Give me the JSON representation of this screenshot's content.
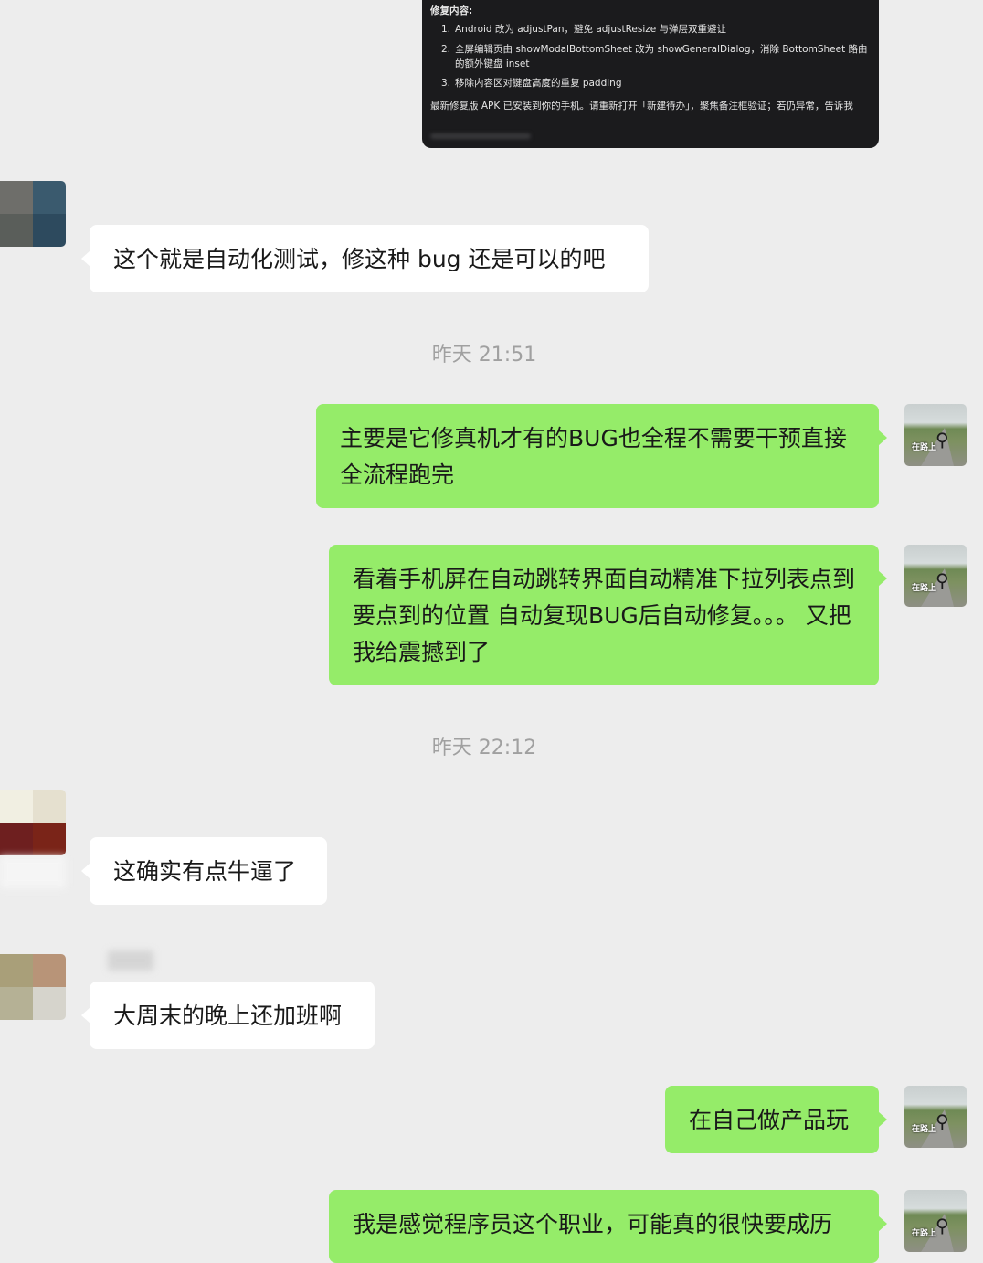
{
  "screenshot_message": {
    "heading": "修复内容:",
    "items": [
      {
        "num": "1.",
        "text": "Android 改为 adjustPan，避免 adjustResize 与弹层双重避让"
      },
      {
        "num": "2.",
        "text": "全屏编辑页由 showModalBottomSheet 改为 showGeneralDialog，消除 BottomSheet 路由的额外键盘 inset"
      },
      {
        "num": "3.",
        "text": "移除内容区对键盘高度的重复 padding"
      }
    ],
    "footer": "最新修复版 APK 已安装到你的手机。请重新打开「新建待办」，聚焦备注框验证；若仍异常，告诉我"
  },
  "messages": {
    "m1": "这个就是自动化测试，修这种 bug 还是可以的吧",
    "t1": "昨天 21:51",
    "m2": "主要是它修真机才有的BUG也全程不需要干预直接全流程跑完",
    "m3": "看着手机屏在自动跳转界面自动精准下拉列表点到要点到的位置 自动复现BUG后自动修复。。。 又把我给震撼到了",
    "t2": "昨天 22:12",
    "m4": "这确实有点牛逼了",
    "m5": "大周末的晚上还加班啊",
    "m6": "在自己做产品玩",
    "m7": "我是感觉程序员这个职业，可能真的很快要成历"
  },
  "avatar_caption": "在路上",
  "colors": {
    "background": "#ededed",
    "bubble_out": "#95ec69",
    "bubble_in": "#ffffff",
    "timestamp": "#a0a0a0"
  }
}
